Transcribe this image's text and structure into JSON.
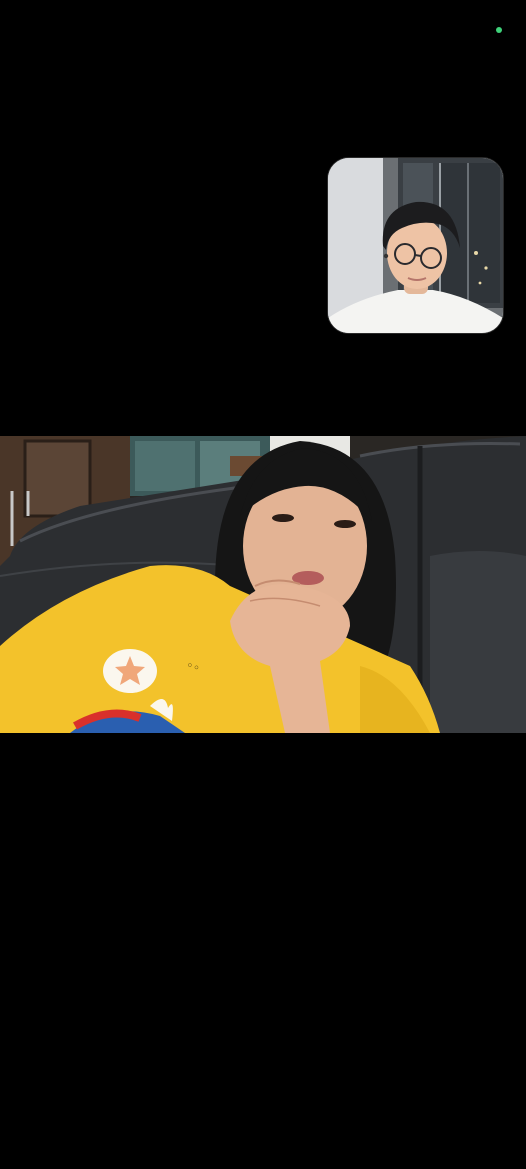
{
  "call": {
    "state": "video-call",
    "indicator_color": "#3fd27a",
    "self_view": {
      "icon": "self-camera-preview"
    },
    "remote_view": {
      "icon": "remote-video-feed"
    }
  },
  "colors": {
    "background": "#000000",
    "shirt_yellow": "#f3c22b",
    "sofa_leather": "#2b2d30"
  }
}
